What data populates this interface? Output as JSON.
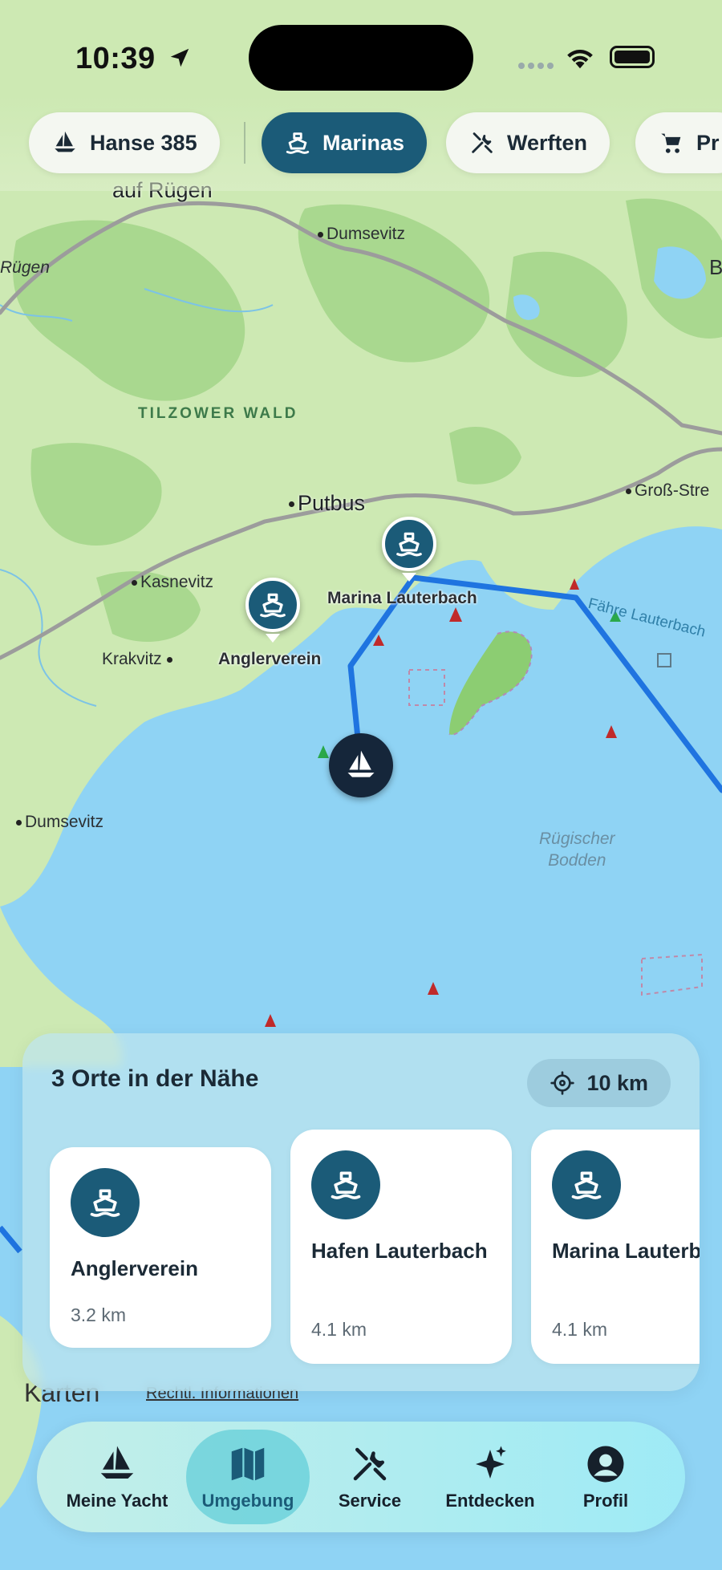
{
  "status_bar": {
    "time": "10:39"
  },
  "chips": [
    {
      "label": "Hanse 385",
      "icon": "sailboat-icon",
      "active": false
    },
    {
      "label": "Marinas",
      "icon": "ship-icon",
      "active": true
    },
    {
      "label": "Werften",
      "icon": "tools-icon",
      "active": false
    },
    {
      "label": "Pr",
      "icon": "cart-icon",
      "active": false
    }
  ],
  "map": {
    "labels": {
      "auf_rugen": "auf Rügen",
      "dumsevitz_top": "Dumsevitz",
      "rugen": "Rügen",
      "b": "B",
      "tilzower_wald": "TILZOWER WALD",
      "putbus": "Putbus",
      "gross_strei": "Groß-Stre",
      "kasnevitz": "Kasnevitz",
      "krakvitz": "Krakvitz",
      "anglerverein": "Anglerverein",
      "marina_lauterbach": "Marina Lauterbach",
      "faehre": "Fähre Lauterbach",
      "dumsevitz_left": "Dumsevitz",
      "rugischer": "Rügischer",
      "bodden": "Bodden",
      "karten": "Karten",
      "rechtl": "Rechtl. Informationen"
    }
  },
  "nearby": {
    "title": "3 Orte in der Nähe",
    "radius": "10 km",
    "places": [
      {
        "name": "Anglerverein",
        "distance": "3.2 km"
      },
      {
        "name": "Hafen Lauterbach",
        "distance": "4.1 km"
      },
      {
        "name": "Marina Lauterbach",
        "distance": "4.1 km"
      }
    ]
  },
  "tabs": [
    {
      "label": "Meine Yacht",
      "icon": "sailboat-icon"
    },
    {
      "label": "Umgebung",
      "icon": "map-icon",
      "active": true
    },
    {
      "label": "Service",
      "icon": "tools-icon"
    },
    {
      "label": "Entdecken",
      "icon": "sparkles-icon"
    },
    {
      "label": "Profil",
      "icon": "person-icon"
    }
  ],
  "colors": {
    "accent": "#1b5b78",
    "water": "#8fd3f4",
    "land": "#cde9b3",
    "route": "#1f74e0"
  }
}
